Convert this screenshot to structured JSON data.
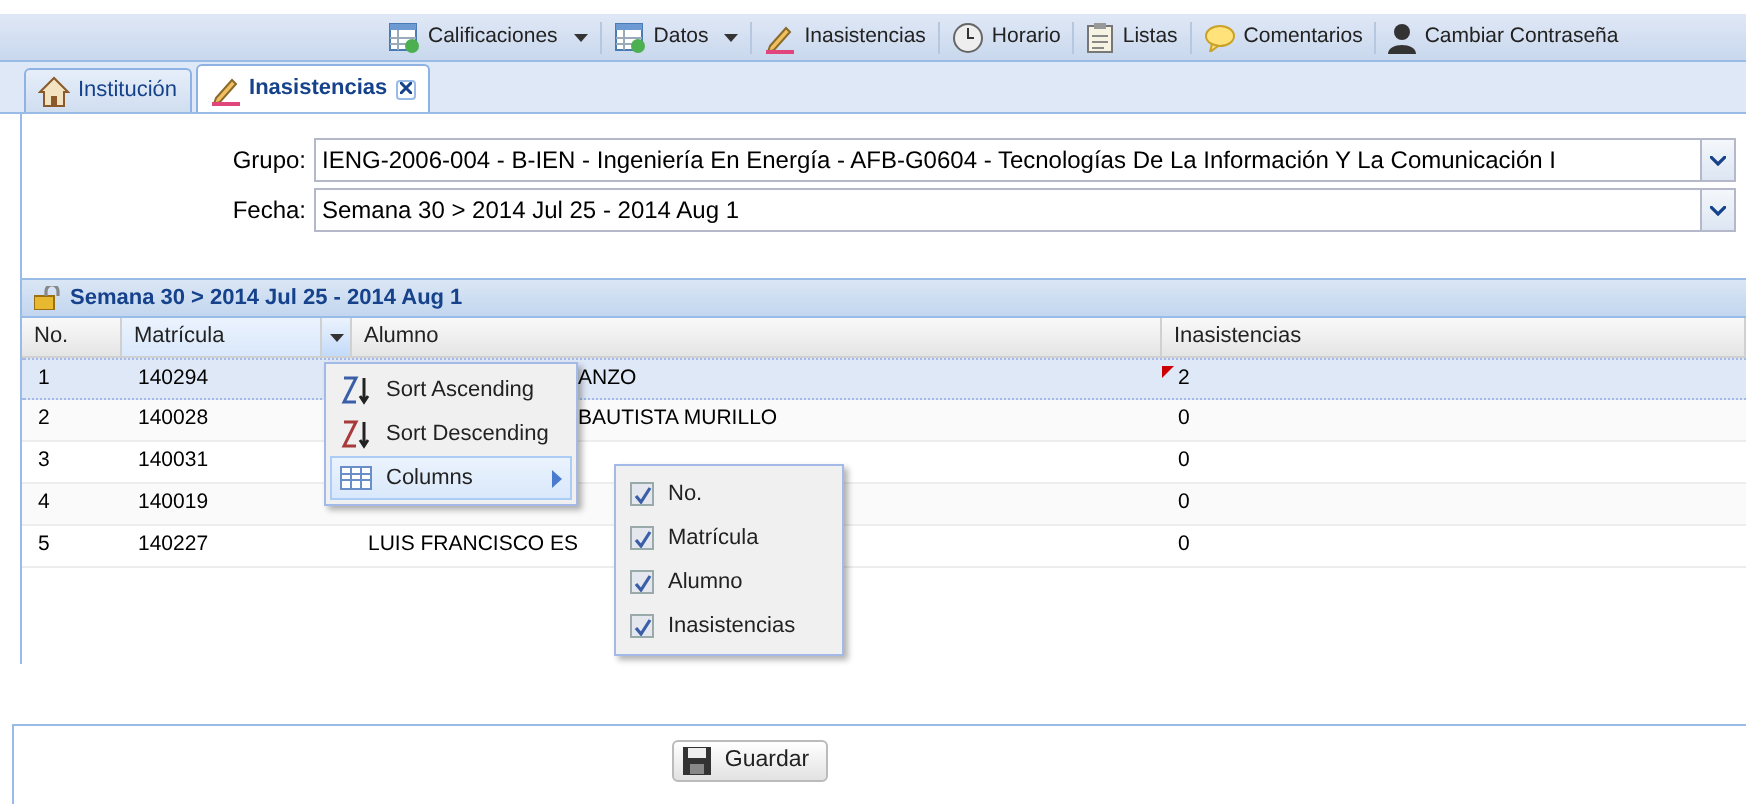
{
  "toolbar": [
    {
      "label": "Calificaciones",
      "kind": "grid",
      "menu": true
    },
    {
      "label": "Datos",
      "kind": "grid",
      "menu": true
    },
    {
      "label": "Inasistencias",
      "kind": "pencil",
      "menu": false
    },
    {
      "label": "Horario",
      "kind": "clock",
      "menu": false
    },
    {
      "label": "Listas",
      "kind": "clipboard",
      "menu": false
    },
    {
      "label": "Comentarios",
      "kind": "speech",
      "menu": false
    },
    {
      "label": "Cambiar Contraseña",
      "kind": "person",
      "menu": false
    }
  ],
  "tabs": [
    {
      "label": "Institución",
      "kind": "house",
      "selected": false,
      "closable": false
    },
    {
      "label": "Inasistencias",
      "kind": "pencil",
      "selected": true,
      "closable": true
    }
  ],
  "form": [
    {
      "label": "Grupo:",
      "value": "IENG-2006-004 - B-IEN - Ingeniería En Energía - AFB-G0604 - Tecnologías De La Información Y La Comunicación I"
    },
    {
      "label": "Fecha:",
      "value": "Semana 30 > 2014 Jul 25 - 2014 Aug 1"
    }
  ],
  "grid": {
    "title": "Semana 30 > 2014 Jul 25 - 2014 Aug 1",
    "columns": [
      {
        "label": "No.",
        "menu_open": false
      },
      {
        "label": "Matrícula",
        "menu_open": true
      },
      {
        "label": "Alumno",
        "menu_open": false
      },
      {
        "label": "Inasistencias",
        "menu_open": false
      }
    ],
    "rows": [
      {
        "no": "1",
        "matricula": "140294",
        "alumno": "ANZO",
        "alumno_covered": true,
        "inasistencias": "2",
        "modified": true,
        "selected": true
      },
      {
        "no": "2",
        "matricula": "140028",
        "alumno": "BAUTISTA MURILLO",
        "alumno_covered": true,
        "inasistencias": "0",
        "modified": false,
        "selected": false
      },
      {
        "no": "3",
        "matricula": "140031",
        "inasistencias": "0",
        "modified": false,
        "selected": false
      },
      {
        "no": "4",
        "matricula": "140019",
        "inasistencias": "0",
        "modified": false,
        "selected": false
      },
      {
        "no": "5",
        "matricula": "140227",
        "alumno": "LUIS FRANCISCO ES",
        "alumno_covered": false,
        "inasistencias": "0",
        "modified": false,
        "selected": false
      }
    ],
    "column_menu": [
      {
        "label": "Sort Ascending",
        "kind": "sort-asc",
        "highlighted": false
      },
      {
        "label": "Sort Descending",
        "kind": "sort-desc",
        "highlighted": false
      },
      {
        "label": "Columns",
        "kind": "submenu",
        "highlighted": true
      }
    ],
    "columns_submenu": [
      {
        "label": "No.",
        "checked": true
      },
      {
        "label": "Matrícula",
        "checked": true
      },
      {
        "label": "Alumno",
        "checked": true
      },
      {
        "label": "Inasistencias",
        "checked": true
      }
    ]
  },
  "save_button": {
    "label": "Guardar"
  }
}
